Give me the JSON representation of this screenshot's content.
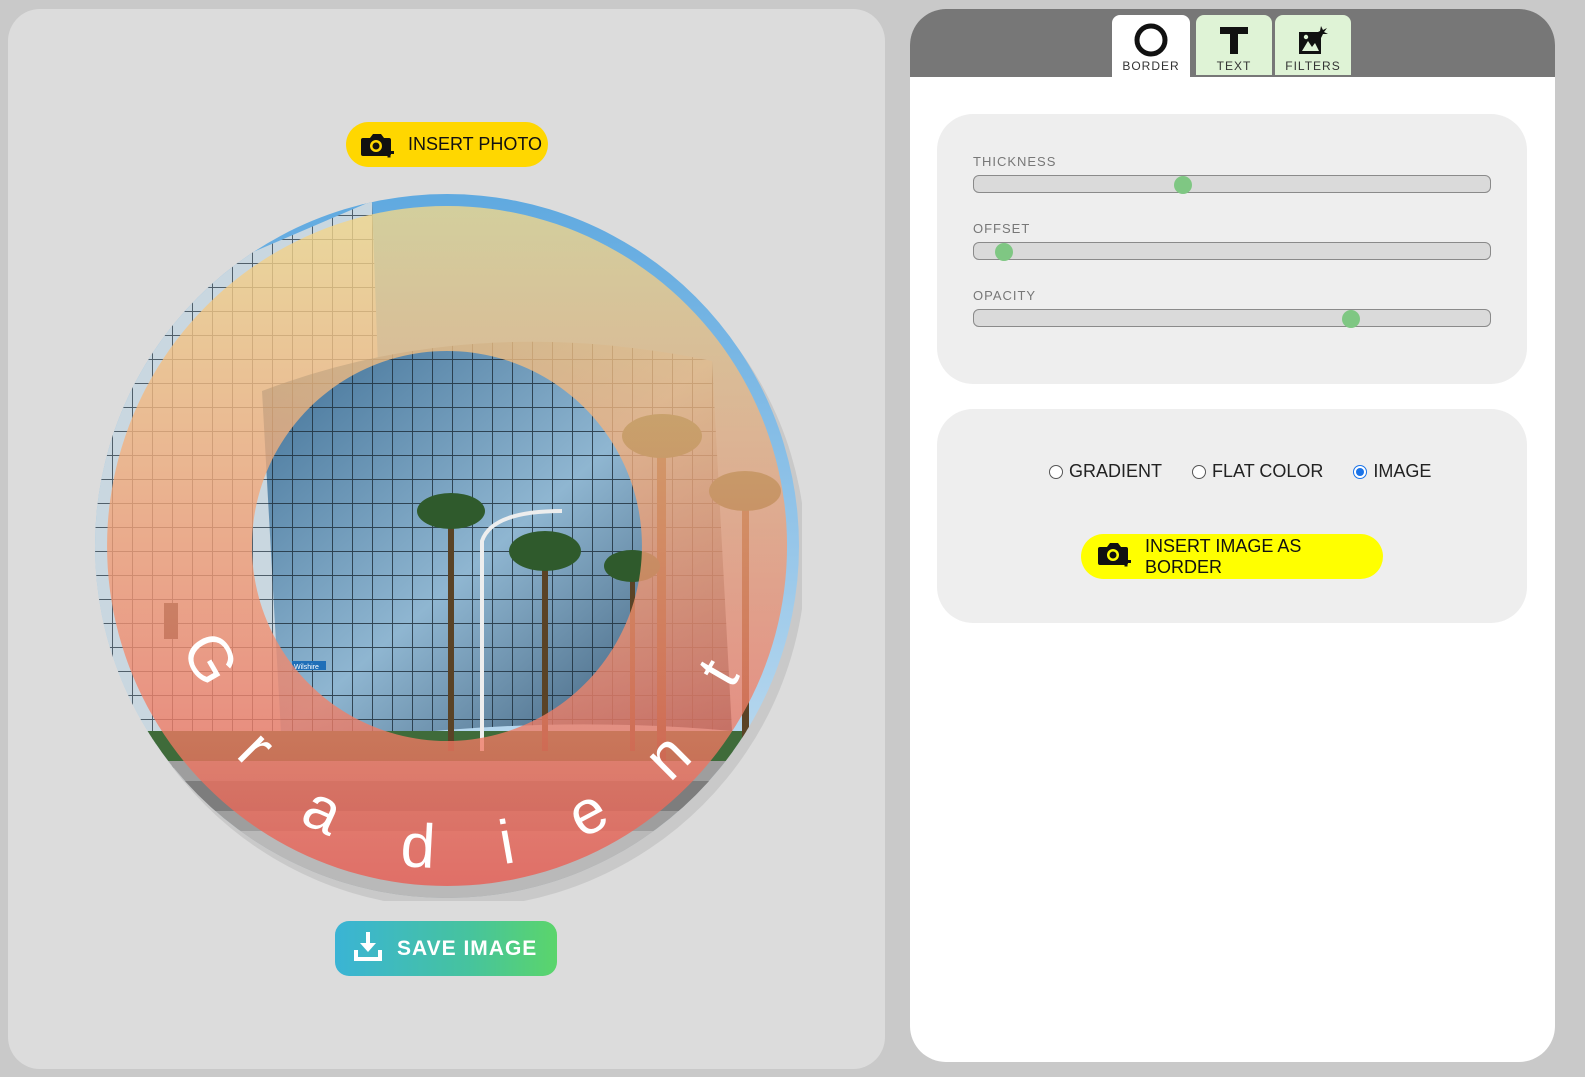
{
  "left": {
    "insert_photo_label": "INSERT PHOTO",
    "save_image_label": "SAVE IMAGE",
    "ring_text": [
      "G",
      "r",
      "a",
      "d",
      "i",
      "e",
      "n",
      "t"
    ],
    "sign_text": "Wilshire"
  },
  "tabs": [
    {
      "label": "BORDER",
      "icon": "circle-ring-icon",
      "active": true
    },
    {
      "label": "TEXT",
      "icon": "text-t-icon",
      "active": false
    },
    {
      "label": "FILTERS",
      "icon": "image-sparkle-icon",
      "active": false
    }
  ],
  "sliders": [
    {
      "label": "THICKNESS",
      "value": 0.405
    },
    {
      "label": "OFFSET",
      "value": 0.058
    },
    {
      "label": "OPACITY",
      "value": 0.73
    }
  ],
  "fill_options": {
    "options": [
      "GRADIENT",
      "FLAT COLOR",
      "IMAGE"
    ],
    "selected": "IMAGE"
  },
  "insert_border_label": "INSERT IMAGE AS BORDER",
  "colors": {
    "photo_button": "#ffd700",
    "border_button": "#ffff00",
    "slider_thumb": "#7fc783",
    "tab_bg": "#dff3d6",
    "ring_gradient_top": "#f3d98a",
    "ring_gradient_bottom": "#ef5f55"
  }
}
